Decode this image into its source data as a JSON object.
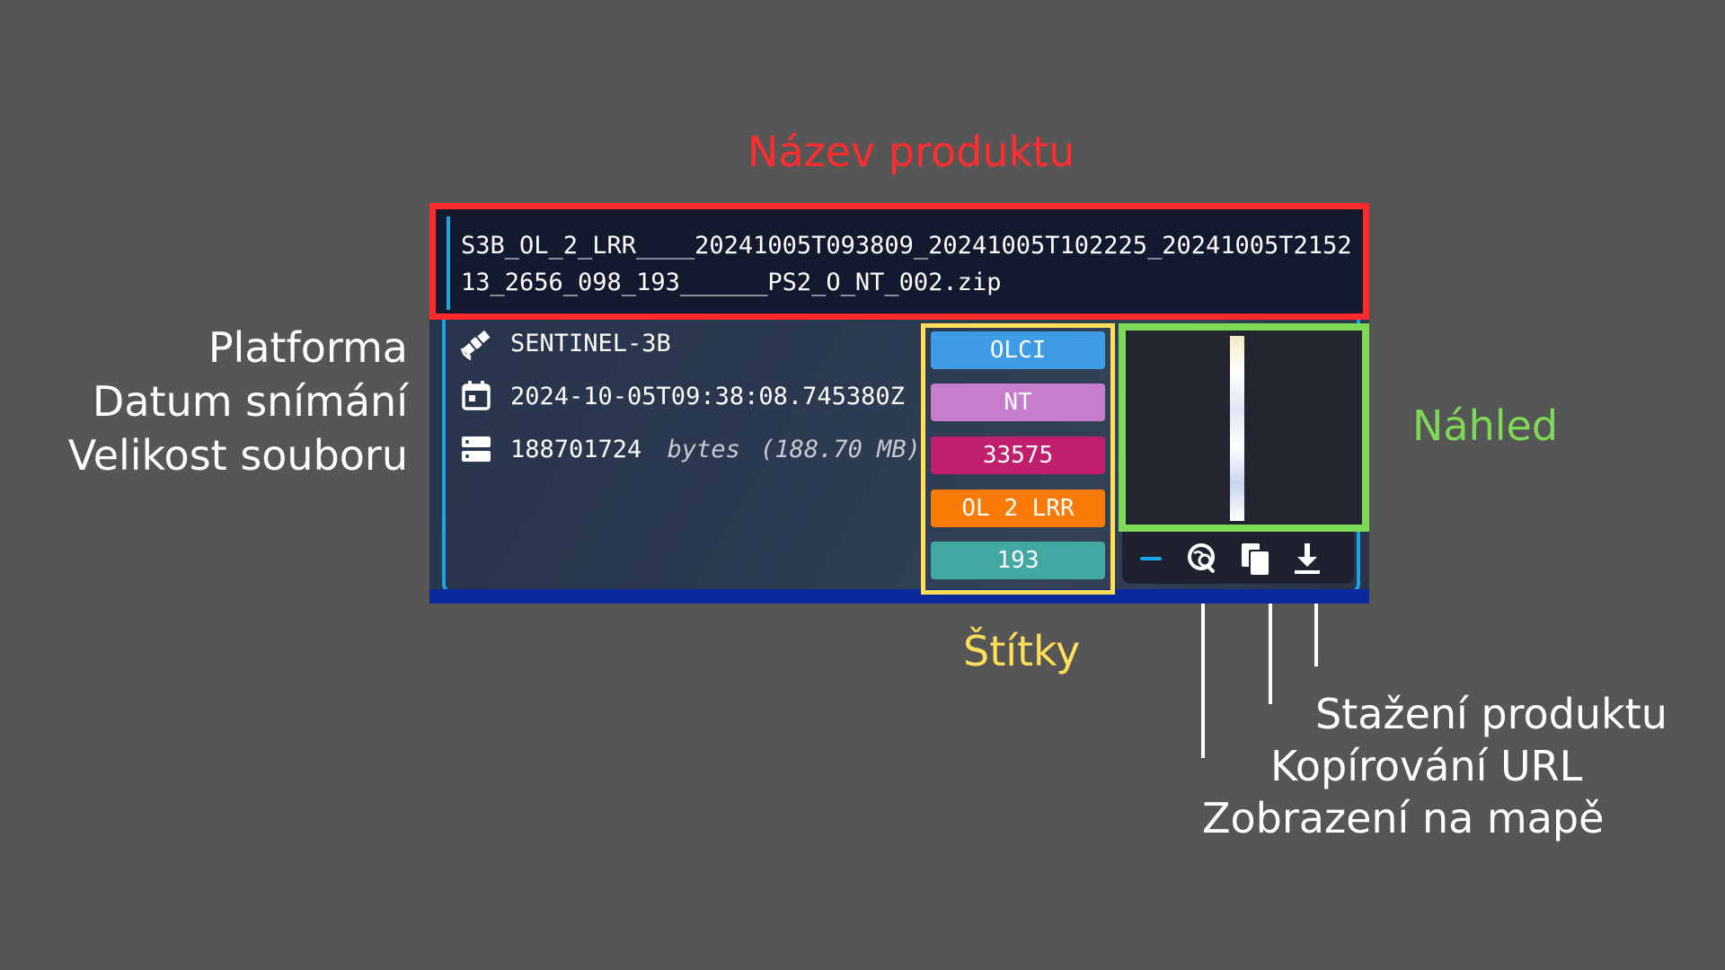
{
  "annotations": {
    "product_name": "Název produktu",
    "platform": "Platforma",
    "acquisition_date": "Datum snímání",
    "file_size": "Velikost souboru",
    "preview": "Náhled",
    "tags": "Štítky",
    "download": "Stažení produktu",
    "copy_url": "Kopírování URL",
    "show_on_map": "Zobrazení na mapě"
  },
  "product": {
    "name": "S3B_OL_2_LRR____20241005T093809_20241005T102225_20241005T215213_2656_098_193______PS2_O_NT_002.zip",
    "platform": "SENTINEL-3B",
    "date": "2024-10-05T09:38:08.745380Z",
    "size_bytes": "188701724",
    "size_unit": "bytes",
    "size_human": "(188.70 MB)"
  },
  "tags": [
    {
      "label": "OLCI",
      "color": "#3f9be3"
    },
    {
      "label": "NT",
      "color": "#c77ccc"
    },
    {
      "label": "33575",
      "color": "#bf1f6d"
    },
    {
      "label": "OL 2 LRR",
      "color": "#f97a07"
    },
    {
      "label": "193",
      "color": "#44a8a2"
    }
  ],
  "toolbar": {
    "collapse_icon": "minus-icon",
    "map_icon": "map-search-icon",
    "copy_icon": "copy-icon",
    "download_icon": "download-icon"
  },
  "colors": {
    "background": "#565656",
    "name_highlight": "#ff2a2a",
    "preview_highlight": "#7ed957",
    "tags_highlight": "#ffde59",
    "card_accent": "#1aa4e8"
  }
}
